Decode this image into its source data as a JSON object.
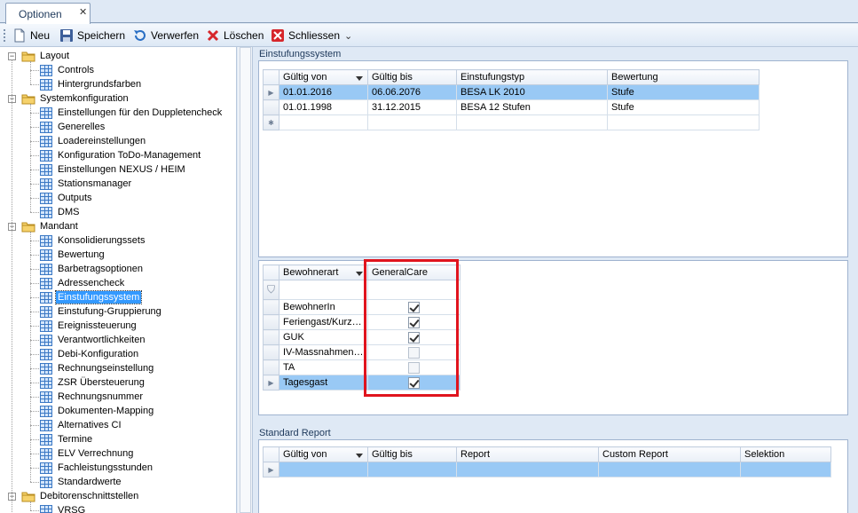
{
  "tabs": [
    {
      "label": "Optionen",
      "close_glyph": "✕"
    }
  ],
  "toolbar": {
    "new_label": "Neu",
    "save_label": "Speichern",
    "discard_label": "Verwerfen",
    "delete_label": "Löschen",
    "close_label": "Schliessen",
    "overflow_glyph": "⌄"
  },
  "tree": {
    "groups": [
      {
        "label": "Layout",
        "items": [
          "Controls",
          "Hintergrundsfarben"
        ]
      },
      {
        "label": "Systemkonfiguration",
        "items": [
          "Einstellungen für den Duppletencheck",
          "Generelles",
          "Loadereinstellungen",
          "Konfiguration ToDo-Management",
          "Einstellungen NEXUS / HEIM",
          "Stationsmanager",
          "Outputs",
          "DMS"
        ]
      },
      {
        "label": "Mandant",
        "items": [
          "Konsolidierungssets",
          "Bewertung",
          "Barbetragsoptionen",
          "Adressencheck",
          "Einstufungssystem",
          "Einstufung-Gruppierung",
          "Ereignissteuerung",
          "Verantwortlichkeiten",
          "Debi-Konfiguration",
          "Rechnungseinstellung",
          "ZSR Übersteuerung",
          "Rechnungsnummer",
          "Dokumenten-Mapping",
          "Alternatives CI",
          "Termine",
          "ELV Verrechnung",
          "Fachleistungsstunden",
          "Standardwerte"
        ]
      },
      {
        "label": "Debitorenschnittstellen",
        "items": [
          "VRSG"
        ]
      }
    ],
    "selected": "Einstufungssystem",
    "expander_glyph": "−"
  },
  "einstufung": {
    "title": "Einstufungssystem",
    "columns": [
      "Gültig von",
      "Gültig bis",
      "Einstufungstyp",
      "Bewertung"
    ],
    "rows": [
      [
        "01.01.2016",
        "06.06.2076",
        "BESA LK 2010",
        "Stufe"
      ],
      [
        "01.01.1998",
        "31.12.2015",
        "BESA 12 Stufen",
        "Stufe"
      ]
    ],
    "selected_row": 0,
    "new_row_glyph": "✱",
    "current_row_glyph": "▶"
  },
  "bewohner": {
    "columns": [
      "Bewohnerart",
      "GeneralCare"
    ],
    "filter_glyph": "⛉",
    "rows": [
      {
        "label": "BewohnerIn",
        "checked": true
      },
      {
        "label": "Feriengast/Kurzaufenthalt",
        "checked": true
      },
      {
        "label": "GUK",
        "checked": true
      },
      {
        "label": "IV-Massnahmen ...",
        "checked": false
      },
      {
        "label": "TA",
        "checked": false
      },
      {
        "label": "Tagesgast",
        "checked": true
      }
    ],
    "selected_row": 5
  },
  "report": {
    "title": "Standard Report",
    "columns": [
      "Gültig von",
      "Gültig bis",
      "Report",
      "Custom Report",
      "Selektion"
    ]
  },
  "colors": {
    "accent": "#3399ff",
    "highlight_box": "#e0141e",
    "selected_row": "#99c9f5"
  }
}
